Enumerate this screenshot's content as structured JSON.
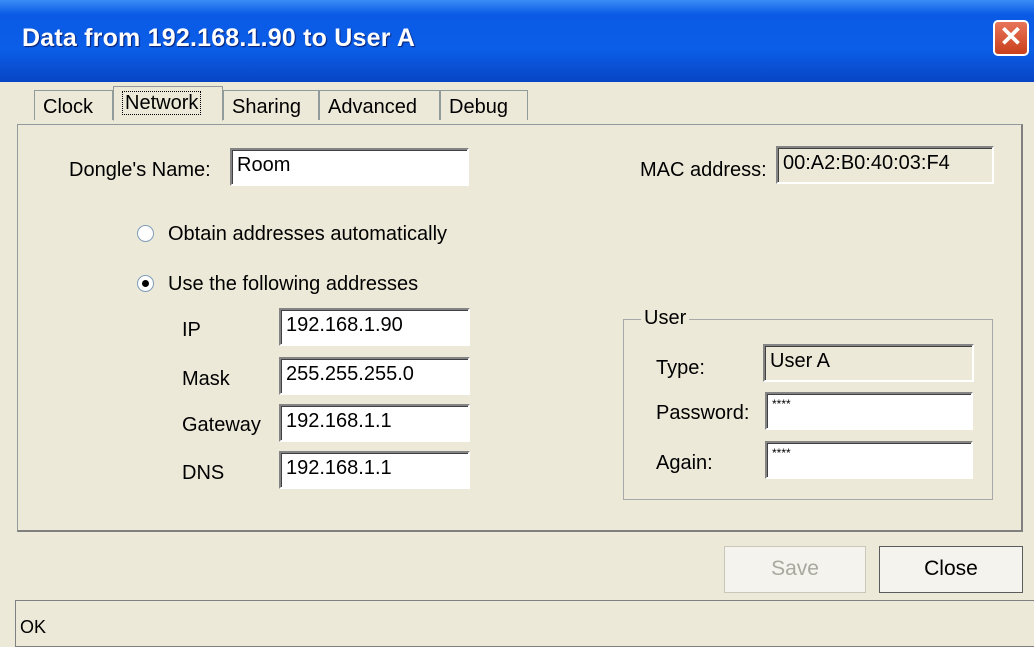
{
  "window": {
    "title": "Data from 192.168.1.90 to User A",
    "close_glyph": "✕"
  },
  "tabs": [
    {
      "label": "Clock"
    },
    {
      "label": "Network"
    },
    {
      "label": "Sharing"
    },
    {
      "label": "Advanced"
    },
    {
      "label": "Debug"
    }
  ],
  "network": {
    "dongle_name_label": "Dongle's Name:",
    "dongle_name_value": "Room",
    "mac_label": "MAC address:",
    "mac_value": "00:A2:B0:40:03:F4",
    "radio_auto_label": "Obtain addresses automatically",
    "radio_manual_label": "Use the following addresses",
    "ip_label": "IP",
    "ip_value": "192.168.1.90",
    "mask_label": "Mask",
    "mask_value": "255.255.255.0",
    "gateway_label": "Gateway",
    "gateway_value": "192.168.1.1",
    "dns_label": "DNS",
    "dns_value": "192.168.1.1"
  },
  "user": {
    "group_label": "User",
    "type_label": "Type:",
    "type_value": "User A",
    "password_label": "Password:",
    "password_value": "****",
    "again_label": "Again:",
    "again_value": "****"
  },
  "buttons": {
    "save": "Save",
    "close": "Close"
  },
  "status": {
    "text": "OK"
  }
}
